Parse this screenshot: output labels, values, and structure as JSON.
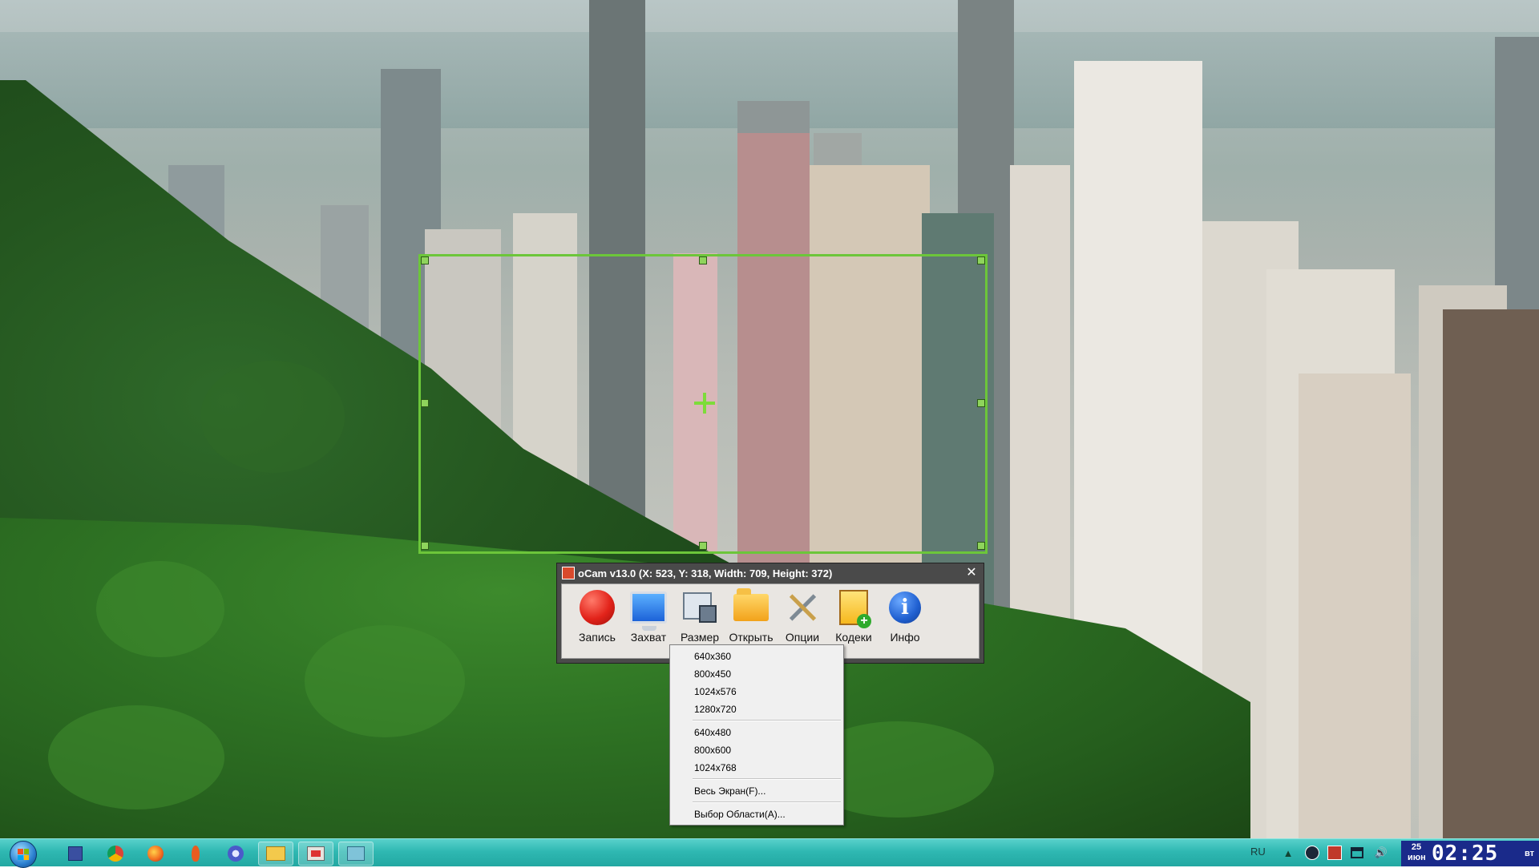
{
  "ocam": {
    "title": "oCam v13.0 (X: 523, Y: 318, Width: 709, Height: 372)",
    "close_glyph": "✕",
    "toolbar": [
      {
        "label": "Запись",
        "icon": "record-icon"
      },
      {
        "label": "Захват",
        "icon": "capture-icon"
      },
      {
        "label": "Размер",
        "icon": "resize-icon"
      },
      {
        "label": "Открыть",
        "icon": "folder-icon"
      },
      {
        "label": "Опции",
        "icon": "options-icon"
      },
      {
        "label": "Кодеки",
        "icon": "codec-icon"
      },
      {
        "label": "Инфо",
        "icon": "info-icon"
      }
    ],
    "info_glyph": "i"
  },
  "size_menu": {
    "items_169": [
      "640x360",
      "800x450",
      "1024x576",
      "1280x720"
    ],
    "items_43": [
      "640x480",
      "800x600",
      "1024x768"
    ],
    "fullscreen": "Весь Экран(F)...",
    "select_area": "Выбор Области(A)..."
  },
  "taskbar": {
    "apps": [
      "save-icon",
      "chrome-icon",
      "firefox-icon",
      "java-icon",
      "browser-icon",
      "explorer-icon",
      "ocam-icon",
      "notes-icon"
    ],
    "language": "RU",
    "clock": {
      "date_line1": "25",
      "date_line2": "июн",
      "time": "02:25",
      "weekday": "вт"
    }
  },
  "colors": {
    "region_border": "#6cc63a",
    "taskbar": "#2fb8b2",
    "clock_bg": "#1a2a8a"
  }
}
